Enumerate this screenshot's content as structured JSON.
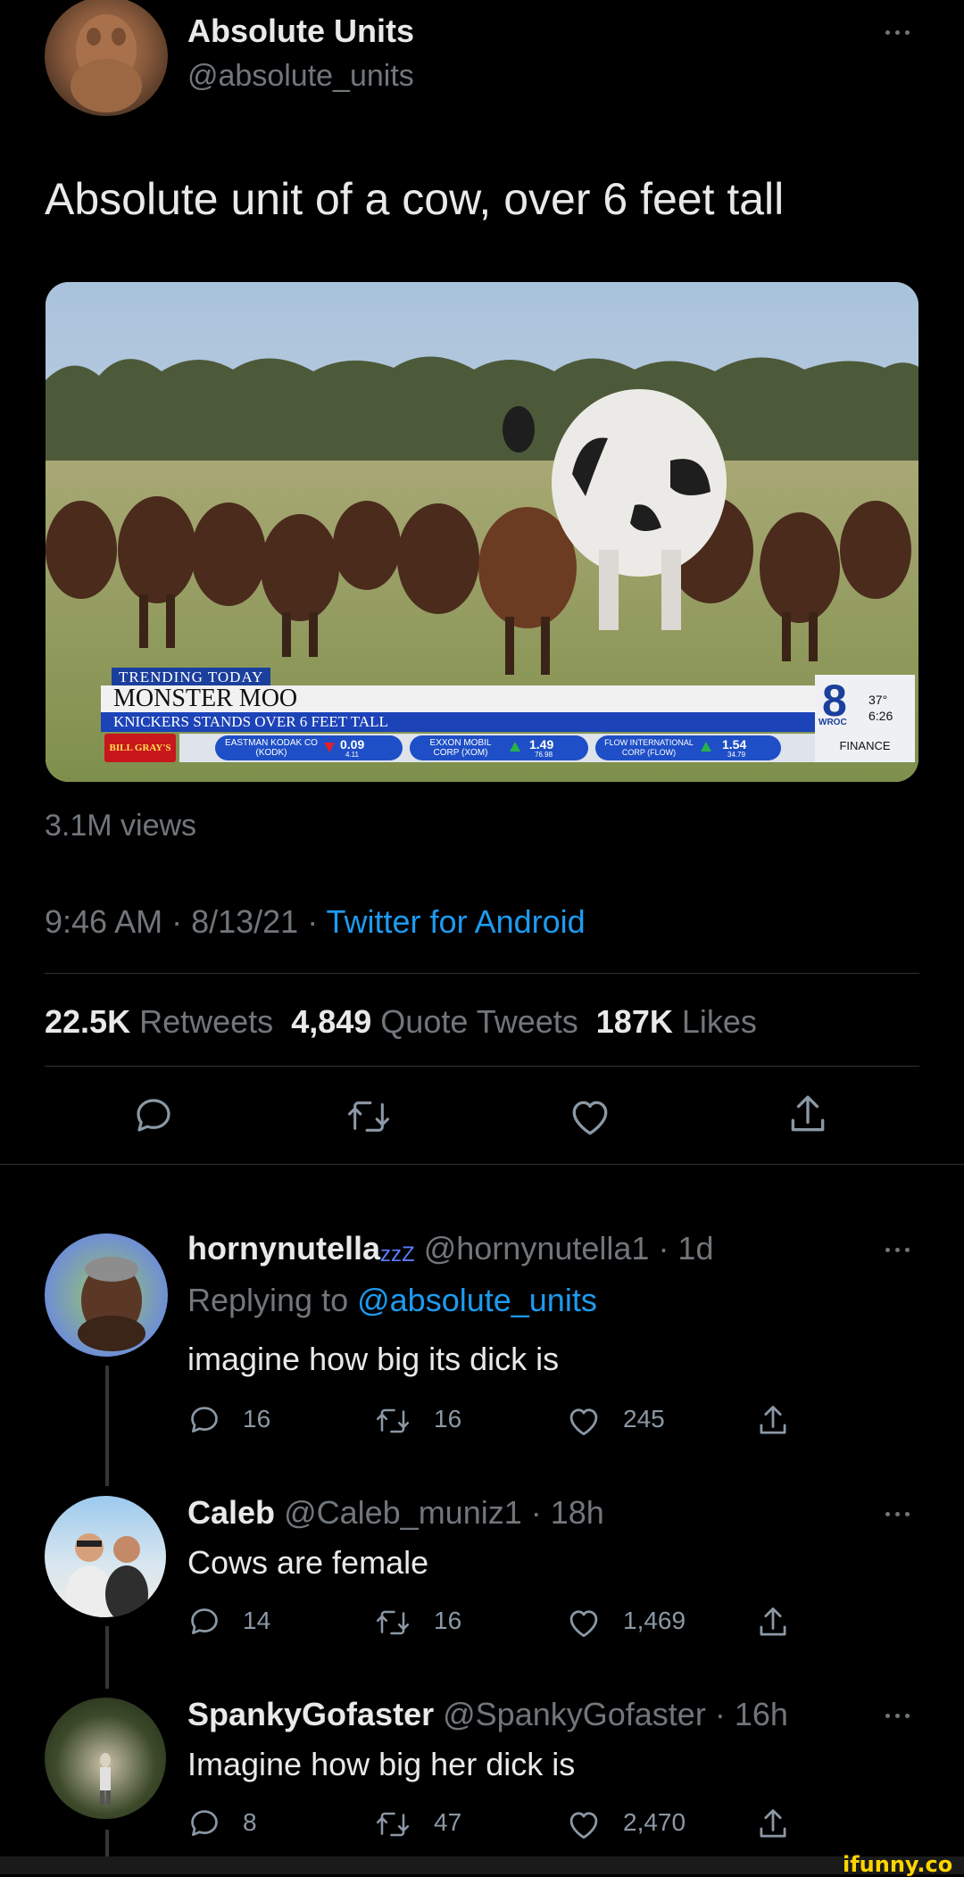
{
  "tweet": {
    "display_name": "Absolute Units",
    "handle": "@absolute_units",
    "text": "Absolute unit of a cow, over 6 feet tall",
    "views": "3.1M views",
    "time": "9:46 AM · 8/13/21 · ",
    "source": "Twitter for Android",
    "stats": {
      "retweets_count": "22.5K",
      "retweets_label": "Retweets",
      "quotes_count": "4,849",
      "quotes_label": "Quote Tweets",
      "likes_count": "187K",
      "likes_label": "Likes"
    }
  },
  "video": {
    "banner_top": "TRENDING TODAY",
    "banner_headline": "MONSTER MOO",
    "banner_sub": "KNICKERS STANDS OVER 6 FEET TALL",
    "sponsor": "BILL GRAY'S",
    "ticker": [
      {
        "name": "EASTMAN KODAK CO (KODK)",
        "change": "0.09",
        "price": "4.11",
        "direction": "down"
      },
      {
        "name": "EXXON MOBIL CORP (XOM)",
        "change": "1.49",
        "price": "76.98",
        "direction": "up"
      },
      {
        "name": "FLOW INTERNATIONAL CORP (FLOW)",
        "change": "1.54",
        "price": "34.79",
        "direction": "up"
      }
    ],
    "channel_number": "8",
    "channel_call": "WROC",
    "temperature": "37°",
    "clock": "6:26",
    "section": "FINANCE"
  },
  "replies": [
    {
      "display_name": "hornynutella",
      "name_suffix": "zzZ",
      "handle": "@hornynutella1",
      "age": "· 1d",
      "replying_prefix": "Replying to ",
      "replying_handle": "@absolute_units",
      "text": "imagine how big its dick is",
      "replies": "16",
      "retweets": "16",
      "likes": "245"
    },
    {
      "display_name": "Caleb",
      "handle": "@Caleb_muniz1",
      "age": "· 18h",
      "text": "Cows are female",
      "replies": "14",
      "retweets": "16",
      "likes": "1,469"
    },
    {
      "display_name": "SpankyGofaster",
      "handle": "@SpankyGofaster",
      "age": "· 16h",
      "text": "Imagine how big her dick is",
      "replies": "8",
      "retweets": "47",
      "likes": "2,470"
    }
  ],
  "watermark": "ifunny.co",
  "colors": {
    "background": "#000000",
    "text": "#e7e9ea",
    "muted": "#71767b",
    "link": "#1d9bf0",
    "divider": "#2f3336",
    "watermark": "#ffd400"
  },
  "icons": [
    "reply-icon",
    "retweet-icon",
    "like-icon",
    "share-icon",
    "more-icon"
  ]
}
